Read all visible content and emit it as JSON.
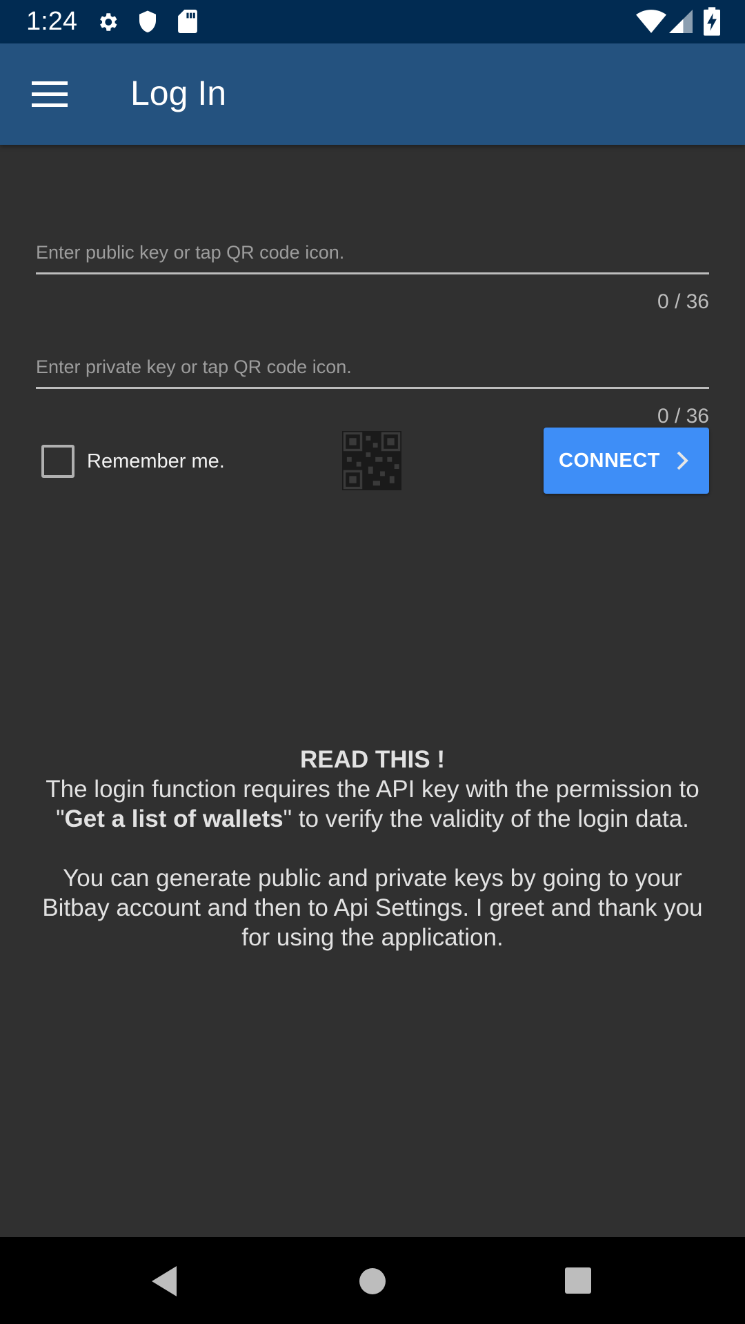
{
  "status_bar": {
    "time": "1:24",
    "icons": [
      "gear-icon",
      "shield-icon",
      "sd-card-icon",
      "wifi-icon",
      "signal-icon",
      "battery-charging-icon"
    ]
  },
  "app_bar": {
    "title": "Log In",
    "menu_icon": "hamburger-menu-icon"
  },
  "form": {
    "public_key": {
      "placeholder": "Enter public key or tap QR code icon.",
      "value": "",
      "counter": "0 / 36"
    },
    "private_key": {
      "placeholder": "Enter private key or tap QR code icon.",
      "value": "",
      "counter": "0 / 36"
    },
    "remember_me": {
      "label": "Remember me.",
      "checked": false
    },
    "qr_icon": "qr-code-icon",
    "connect_label": "CONNECT"
  },
  "info": {
    "heading": "READ THIS !",
    "p1_before": "The login function requires the API key with the permission to \"",
    "p1_bold": "Get a list of wallets",
    "p1_after": "\" to verify the validity of the login data.",
    "p2": "You can generate public and private keys by going to your Bitbay account and then to Api Settings. I greet and thank you for using the application."
  },
  "colors": {
    "status_bar": "#012b52",
    "app_bar": "#24527f",
    "background": "#303030",
    "accent": "#3e8ef7"
  }
}
